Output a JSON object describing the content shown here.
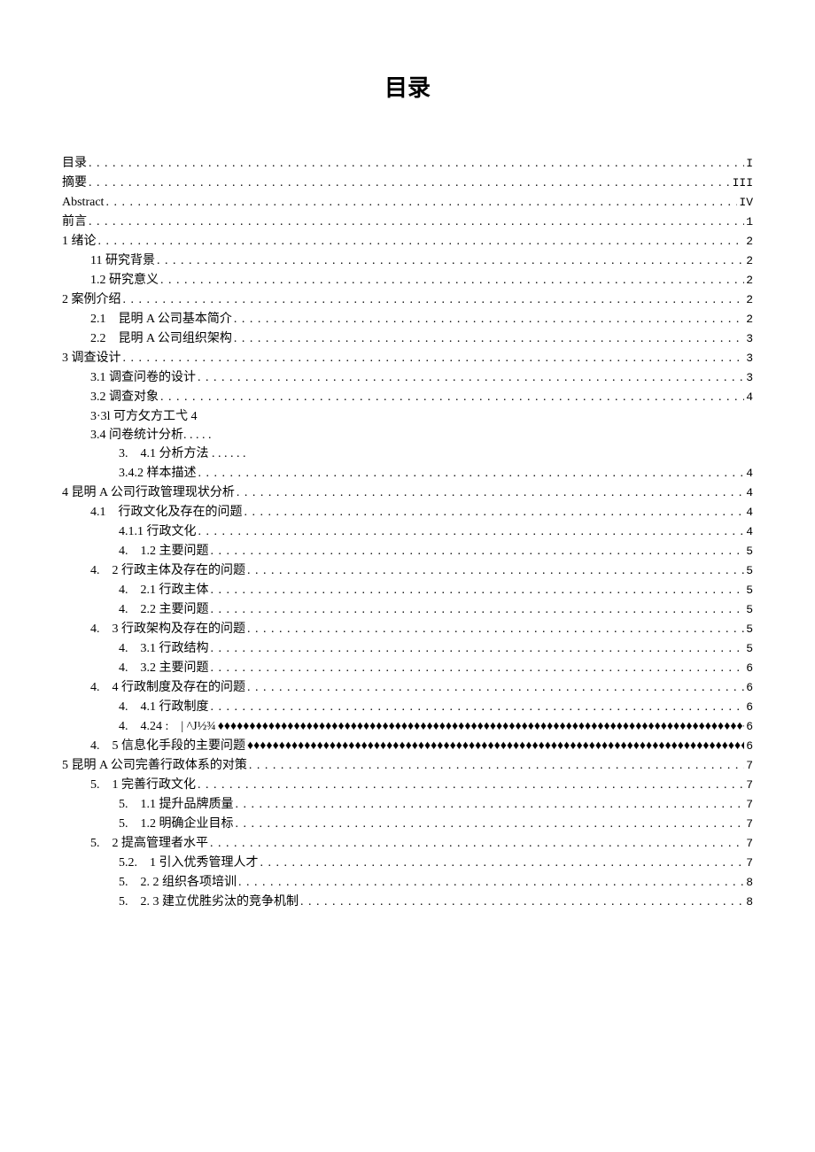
{
  "title": "目录",
  "entries": [
    {
      "indent": 0,
      "label": "目录",
      "page": "I",
      "leader": "dot"
    },
    {
      "indent": 0,
      "label": "摘要",
      "page": "III",
      "leader": "dot"
    },
    {
      "indent": 0,
      "label": "Abstract",
      "page": "IV",
      "leader": "dot"
    },
    {
      "indent": 0,
      "label": "前言",
      "page": "1",
      "leader": "dot"
    },
    {
      "indent": 0,
      "label": "1 绪论",
      "page": "2",
      "leader": "dot"
    },
    {
      "indent": 1,
      "label": "11 研究背景",
      "page": "2",
      "leader": "dot"
    },
    {
      "indent": 1,
      "label": "1.2 研究意义",
      "page": "2",
      "leader": "dot"
    },
    {
      "indent": 0,
      "label": "2 案例介绍",
      "page": "2",
      "leader": "dot"
    },
    {
      "indent": 1,
      "label": "2.1　昆明 A 公司基本简介",
      "page": "2",
      "leader": "dot"
    },
    {
      "indent": 1,
      "label": "2.2　昆明 A 公司组织架构",
      "page": "3",
      "leader": "dot"
    },
    {
      "indent": 0,
      "label": "3 调查设计",
      "page": "3",
      "leader": "dot"
    },
    {
      "indent": 1,
      "label": "3.1 调查问卷的设计",
      "page": "3",
      "leader": "dot"
    },
    {
      "indent": 1,
      "label": "3.2 调查对象",
      "page": "4",
      "leader": "dot"
    },
    {
      "indent": 1,
      "label": "3·3l 可方攵方工弋 4",
      "page": "",
      "leader": "none"
    },
    {
      "indent": 1,
      "label": "3.4 问卷统计分析. . . . .",
      "page": "",
      "leader": "none"
    },
    {
      "indent": 2,
      "label": "3.　4.1 分析方法 . . . . . .",
      "page": "",
      "leader": "none"
    },
    {
      "indent": 2,
      "label": "3.4.2 样本描述",
      "page": "4",
      "leader": "dot"
    },
    {
      "indent": 0,
      "label": "4 昆明 A 公司行政管理现状分析",
      "page": "4",
      "leader": "dot"
    },
    {
      "indent": 1,
      "label": "4.1　行政文化及存在的问题",
      "page": "4",
      "leader": "dot"
    },
    {
      "indent": 2,
      "label": "4.1.1 行政文化",
      "page": "4",
      "leader": "dot"
    },
    {
      "indent": 2,
      "label": "4.　1.2 主要问题",
      "page": "5",
      "leader": "dot"
    },
    {
      "indent": 1,
      "label": "4.　2 行政主体及存在的问题",
      "page": "5",
      "leader": "dot"
    },
    {
      "indent": 2,
      "label": "4.　2.1 行政主体",
      "page": "5",
      "leader": "dot"
    },
    {
      "indent": 2,
      "label": "4.　2.2 主要问题",
      "page": "5",
      "leader": "dot"
    },
    {
      "indent": 1,
      "label": "4.　3 行政架构及存在的问题",
      "page": "5",
      "leader": "dot"
    },
    {
      "indent": 2,
      "label": "4.　3.1 行政结构",
      "page": "5",
      "leader": "dot"
    },
    {
      "indent": 2,
      "label": "4.　3.2 主要问题",
      "page": "6",
      "leader": "dot"
    },
    {
      "indent": 1,
      "label": "4.　4 行政制度及存在的问题",
      "page": "6",
      "leader": "dot"
    },
    {
      "indent": 2,
      "label": "4.　4.1 行政制度",
      "page": "6",
      "leader": "dot"
    },
    {
      "indent": 2,
      "label": "4.　4.24 :　| ^J½¾",
      "page": "6",
      "leader": "diamond"
    },
    {
      "indent": 1,
      "label": "4.　5 信息化手段的主要问题",
      "page": "6",
      "leader": "diamond"
    },
    {
      "indent": 0,
      "label": "5 昆明 A 公司完善行政体系的对策",
      "page": "7",
      "leader": "dot"
    },
    {
      "indent": 1,
      "label": "5.　1 完善行政文化",
      "page": "7",
      "leader": "dot"
    },
    {
      "indent": 2,
      "label": "5.　1.1 提升品牌质量",
      "page": "7",
      "leader": "dot"
    },
    {
      "indent": 2,
      "label": "5.　1.2 明确企业目标",
      "page": "7",
      "leader": "dot"
    },
    {
      "indent": 1,
      "label": "5.　2 提高管理者水平",
      "page": "7",
      "leader": "dot"
    },
    {
      "indent": 2,
      "label": "5.2.　1 引入优秀管理人才",
      "page": "7",
      "leader": "dot"
    },
    {
      "indent": 2,
      "label": "5.　2. 2 组织各项培训",
      "page": "8",
      "leader": "dot"
    },
    {
      "indent": 2,
      "label": "5.　2. 3 建立优胜劣汰的竞争机制",
      "page": "8",
      "leader": "dot"
    }
  ]
}
